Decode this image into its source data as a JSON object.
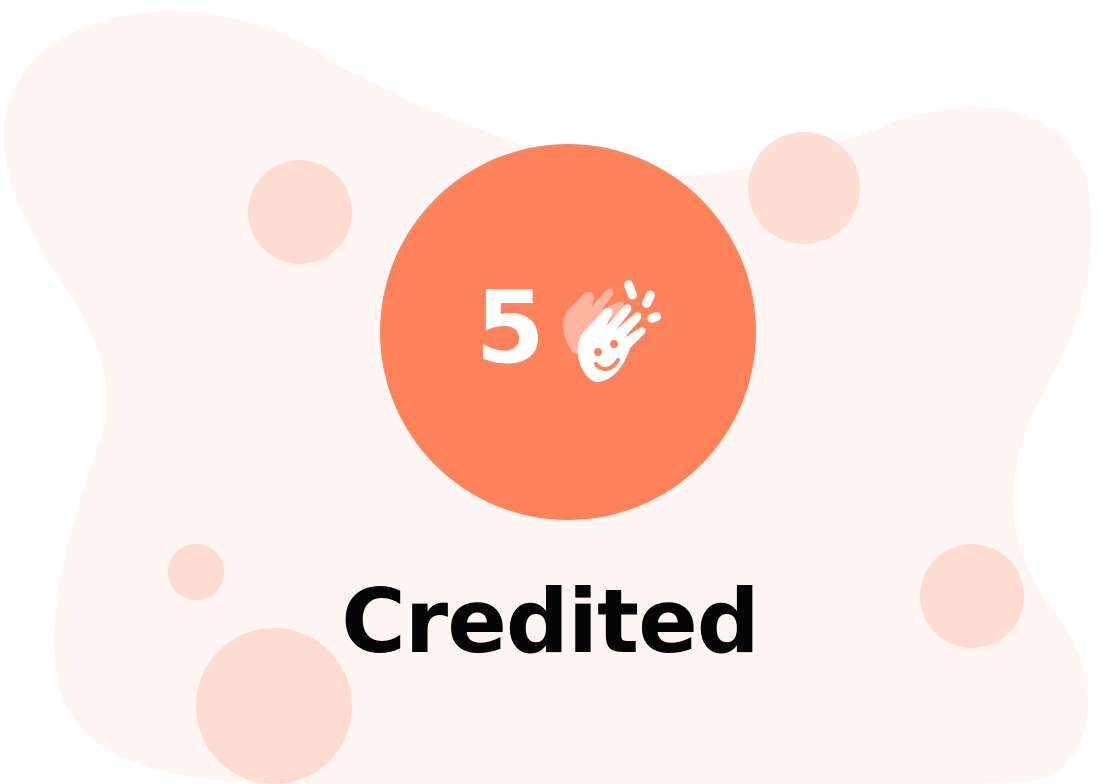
{
  "badge": {
    "count": "5",
    "icon": "clapping-hands-icon",
    "color": "#ff825a"
  },
  "caption": {
    "text": "Credited"
  },
  "colors": {
    "background_blob": "#fff6f3",
    "bubble": "#ffdcd2",
    "badge": "#ff825a",
    "caption_text": "#050505",
    "icon_light": "#ffffff",
    "icon_faded": "#ffb5a1"
  }
}
